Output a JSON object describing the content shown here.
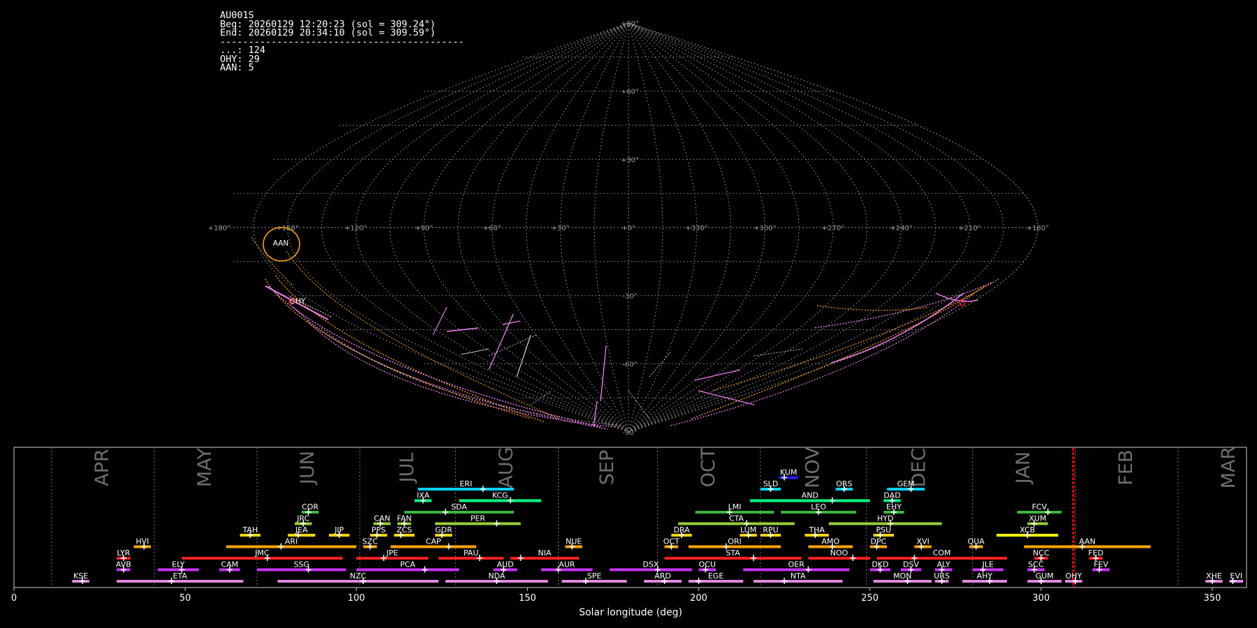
{
  "info": {
    "camera": "AU001S",
    "begin": "Beg: 20260129 12:20:23 (sol = 309.24°)",
    "end": "End: 20260129 20:34:10 (sol = 309.59°)",
    "divider": "-------------------------------------------",
    "counts": [
      "...: 124",
      "OHY: 29",
      "AAN: 5"
    ]
  },
  "sky": {
    "lon_labels": [
      "+180°",
      "+150°",
      "+120°",
      "+90°",
      "+60°",
      "+30°",
      "+0°",
      "+330°",
      "+300°",
      "+270°",
      "+240°",
      "+210°",
      "+180°"
    ],
    "lat_labels": [
      "+90°",
      "+60°",
      "+30°",
      "-30°",
      "-60°",
      "-90°"
    ],
    "radiant_labels": [
      "AAN",
      "OHY"
    ],
    "colors": {
      "grid": "#8a8a8a",
      "aan": "#ffa500",
      "ohy": "#ee82ee",
      "sporadic": "#bfbfbf"
    }
  },
  "timeline": {
    "title": "Solar longitude (deg)",
    "months": [
      "APR",
      "MAY",
      "JUN",
      "JUL",
      "AUG",
      "SEP",
      "OCT",
      "NOV",
      "DEC",
      "JAN",
      "FEB",
      "MAR"
    ],
    "xticks": [
      0,
      50,
      100,
      150,
      200,
      250,
      300,
      350
    ],
    "current_sol": 309.4
  },
  "chart_data": {
    "type": "timeline",
    "xlabel": "Solar longitude (deg)",
    "xlim": [
      0,
      360
    ],
    "current_marker_sol": 309.4,
    "showers": [
      {
        "code": "KUM",
        "start": 223.5,
        "end": 229,
        "peak": 225,
        "row": 9,
        "color": "#1e1eff"
      },
      {
        "code": "SLD",
        "start": 218,
        "end": 224,
        "peak": 221,
        "row": 8,
        "color": "#00d0ff"
      },
      {
        "code": "ORS",
        "start": 240,
        "end": 245,
        "peak": 242.5,
        "row": 8,
        "color": "#00d0ff"
      },
      {
        "code": "GEM",
        "start": 255,
        "end": 266,
        "peak": 262,
        "row": 8,
        "color": "#00d0ff"
      },
      {
        "code": "ERI",
        "start": 118,
        "end": 146,
        "peak": 137,
        "row": 8,
        "color": "#00d0ff"
      },
      {
        "code": "IXA",
        "start": 117,
        "end": 122,
        "peak": 119.5,
        "row": 7,
        "color": "#00ff7f"
      },
      {
        "code": "KCG",
        "start": 130,
        "end": 154,
        "peak": 145,
        "row": 7,
        "color": "#00ff7f"
      },
      {
        "code": "AND",
        "start": 215,
        "end": 250,
        "peak": 239,
        "row": 7,
        "color": "#00ff7f"
      },
      {
        "code": "DAD",
        "start": 254,
        "end": 259,
        "peak": 256.5,
        "row": 7,
        "color": "#00ff7f"
      },
      {
        "code": "COR",
        "start": 84,
        "end": 89,
        "peak": 86,
        "row": 6,
        "color": "#3cb43c"
      },
      {
        "code": "SDA",
        "start": 114,
        "end": 146,
        "peak": 126,
        "row": 6,
        "color": "#3cb43c"
      },
      {
        "code": "LMI",
        "start": 199,
        "end": 222,
        "peak": 209,
        "row": 6,
        "color": "#3cb43c"
      },
      {
        "code": "LEO",
        "start": 224,
        "end": 246,
        "peak": 235,
        "row": 6,
        "color": "#3cb43c"
      },
      {
        "code": "EHY",
        "start": 254,
        "end": 260,
        "peak": 257,
        "row": 6,
        "color": "#3cb43c"
      },
      {
        "code": "FCV",
        "start": 293,
        "end": 306,
        "peak": 302,
        "row": 6,
        "color": "#3cb43c"
      },
      {
        "code": "JRC",
        "start": 82,
        "end": 87,
        "peak": 84.5,
        "row": 5,
        "color": "#9acd32"
      },
      {
        "code": "CAN",
        "start": 105,
        "end": 110,
        "peak": 107,
        "row": 5,
        "color": "#9acd32"
      },
      {
        "code": "FAN",
        "start": 112,
        "end": 116,
        "peak": 114,
        "row": 5,
        "color": "#9acd32"
      },
      {
        "code": "PER",
        "start": 123,
        "end": 148,
        "peak": 141,
        "row": 5,
        "color": "#9acd32"
      },
      {
        "code": "CTA",
        "start": 194,
        "end": 228,
        "peak": 214,
        "row": 5,
        "color": "#9acd32"
      },
      {
        "code": "HYD",
        "start": 238,
        "end": 271,
        "peak": 256,
        "row": 5,
        "color": "#9acd32"
      },
      {
        "code": "XUM",
        "start": 296,
        "end": 302,
        "peak": 298,
        "row": 5,
        "color": "#9acd32"
      },
      {
        "code": "TAH",
        "start": 66,
        "end": 72,
        "peak": 69,
        "row": 4,
        "color": "#ffd700"
      },
      {
        "code": "JEA",
        "start": 80,
        "end": 88,
        "peak": 83,
        "row": 4,
        "color": "#ffd700"
      },
      {
        "code": "JIP",
        "start": 92,
        "end": 98,
        "peak": 95,
        "row": 4,
        "color": "#ffd700"
      },
      {
        "code": "PPS",
        "start": 104,
        "end": 109,
        "peak": 106,
        "row": 4,
        "color": "#ffd700"
      },
      {
        "code": "ZCS",
        "start": 111,
        "end": 117,
        "peak": 113,
        "row": 4,
        "color": "#ffd700"
      },
      {
        "code": "GDR",
        "start": 123,
        "end": 128,
        "peak": 125,
        "row": 4,
        "color": "#ffd700"
      },
      {
        "code": "DRA",
        "start": 192,
        "end": 198,
        "peak": 195,
        "row": 4,
        "color": "#ffd700"
      },
      {
        "code": "LUM",
        "start": 212,
        "end": 217,
        "peak": 214.5,
        "row": 4,
        "color": "#ffd700"
      },
      {
        "code": "RPU",
        "start": 218,
        "end": 224,
        "peak": 221,
        "row": 4,
        "color": "#ffd700"
      },
      {
        "code": "THA",
        "start": 231,
        "end": 238,
        "peak": 234,
        "row": 4,
        "color": "#ffd700"
      },
      {
        "code": "PSU",
        "start": 251,
        "end": 257,
        "peak": 253,
        "row": 4,
        "color": "#ffd700"
      },
      {
        "code": "XCB",
        "start": 287,
        "end": 305,
        "peak": 296,
        "row": 4,
        "color": "#ffff00"
      },
      {
        "code": "HVI",
        "start": 35,
        "end": 40,
        "peak": 38,
        "row": 3,
        "color": "#ffa500"
      },
      {
        "code": "ARI",
        "start": 62,
        "end": 100,
        "peak": 78,
        "row": 3,
        "color": "#ffa500"
      },
      {
        "code": "SZC",
        "start": 102,
        "end": 106,
        "peak": 104,
        "row": 3,
        "color": "#ffa500"
      },
      {
        "code": "CAP",
        "start": 110,
        "end": 135,
        "peak": 127,
        "row": 3,
        "color": "#ffa500"
      },
      {
        "code": "NUE",
        "start": 161,
        "end": 166,
        "peak": 163,
        "row": 3,
        "color": "#ffa500"
      },
      {
        "code": "OCT",
        "start": 190,
        "end": 194,
        "peak": 192,
        "row": 3,
        "color": "#ffa500"
      },
      {
        "code": "ORI",
        "start": 197,
        "end": 224,
        "peak": 208,
        "row": 3,
        "color": "#ffa500"
      },
      {
        "code": "AMO",
        "start": 232,
        "end": 245,
        "peak": 239,
        "row": 3,
        "color": "#ffa500"
      },
      {
        "code": "DPC",
        "start": 250,
        "end": 255,
        "peak": 252,
        "row": 3,
        "color": "#ffa500"
      },
      {
        "code": "XVI",
        "start": 263,
        "end": 268,
        "peak": 265,
        "row": 3,
        "color": "#ffa500"
      },
      {
        "code": "QUA",
        "start": 279,
        "end": 283,
        "peak": 281,
        "row": 3,
        "color": "#ffa500"
      },
      {
        "code": "AAN",
        "start": 295,
        "end": 332,
        "peak": 312,
        "row": 3,
        "color": "#ffa500"
      },
      {
        "code": "LYR",
        "start": 30,
        "end": 34,
        "peak": 32,
        "row": 2,
        "color": "#ff2020"
      },
      {
        "code": "JMC",
        "start": 49,
        "end": 96,
        "peak": 74,
        "row": 2,
        "color": "#ff2020"
      },
      {
        "code": "JPE",
        "start": 100,
        "end": 121,
        "peak": 108,
        "row": 2,
        "color": "#ff2020"
      },
      {
        "code": "PAU",
        "start": 124,
        "end": 143,
        "peak": 136,
        "row": 2,
        "color": "#ff2020"
      },
      {
        "code": "NIA",
        "start": 145,
        "end": 165,
        "peak": 148,
        "row": 2,
        "color": "#ff2020"
      },
      {
        "code": "STA",
        "start": 190,
        "end": 230,
        "peak": 216,
        "row": 2,
        "color": "#ff2020"
      },
      {
        "code": "NOO",
        "start": 232,
        "end": 250,
        "peak": 245,
        "row": 2,
        "color": "#ff2020"
      },
      {
        "code": "COM",
        "start": 252,
        "end": 290,
        "peak": 263,
        "row": 2,
        "color": "#ff2020"
      },
      {
        "code": "NCC",
        "start": 298,
        "end": 302,
        "peak": 300,
        "row": 2,
        "color": "#ff2020"
      },
      {
        "code": "FED",
        "start": 314,
        "end": 318,
        "peak": 316,
        "row": 2,
        "color": "#ff2020"
      },
      {
        "code": "AVB",
        "start": 30,
        "end": 34,
        "peak": 32,
        "row": 1,
        "color": "#cc33ff"
      },
      {
        "code": "ELY",
        "start": 42,
        "end": 54,
        "peak": 49,
        "row": 1,
        "color": "#cc33ff"
      },
      {
        "code": "CAM",
        "start": 60,
        "end": 66,
        "peak": 63,
        "row": 1,
        "color": "#cc33ff"
      },
      {
        "code": "SSG",
        "start": 71,
        "end": 97,
        "peak": 86,
        "row": 1,
        "color": "#cc33ff"
      },
      {
        "code": "PCA",
        "start": 100,
        "end": 130,
        "peak": 120,
        "row": 1,
        "color": "#cc33ff"
      },
      {
        "code": "AUD",
        "start": 140,
        "end": 147,
        "peak": 143,
        "row": 1,
        "color": "#cc33ff"
      },
      {
        "code": "AUR",
        "start": 154,
        "end": 169,
        "peak": 159,
        "row": 1,
        "color": "#cc33ff"
      },
      {
        "code": "DSX",
        "start": 174,
        "end": 198,
        "peak": 188,
        "row": 1,
        "color": "#cc33ff"
      },
      {
        "code": "OCU",
        "start": 200,
        "end": 205,
        "peak": 202,
        "row": 1,
        "color": "#cc33ff"
      },
      {
        "code": "OER",
        "start": 213,
        "end": 244,
        "peak": 232,
        "row": 1,
        "color": "#cc33ff"
      },
      {
        "code": "DKD",
        "start": 250,
        "end": 256,
        "peak": 253,
        "row": 1,
        "color": "#cc33ff"
      },
      {
        "code": "DSV",
        "start": 259,
        "end": 265,
        "peak": 262,
        "row": 1,
        "color": "#cc33ff"
      },
      {
        "code": "ALY",
        "start": 269,
        "end": 274,
        "peak": 271,
        "row": 1,
        "color": "#cc33ff"
      },
      {
        "code": "ILE",
        "start": 280,
        "end": 289,
        "peak": 283,
        "row": 1,
        "color": "#cc33ff"
      },
      {
        "code": "SCC",
        "start": 296,
        "end": 301,
        "peak": 298,
        "row": 1,
        "color": "#cc33ff"
      },
      {
        "code": "FEV",
        "start": 315,
        "end": 320,
        "peak": 317,
        "row": 1,
        "color": "#cc33ff"
      },
      {
        "code": "KSE",
        "start": 17,
        "end": 22,
        "peak": 20,
        "row": 0,
        "color": "#dd88dd"
      },
      {
        "code": "ETA",
        "start": 30,
        "end": 67,
        "peak": 46,
        "row": 0,
        "color": "#dd88dd"
      },
      {
        "code": "NZC",
        "start": 77,
        "end": 124,
        "peak": 102,
        "row": 0,
        "color": "#dd88dd"
      },
      {
        "code": "NDA",
        "start": 126,
        "end": 156,
        "peak": 141,
        "row": 0,
        "color": "#dd88dd"
      },
      {
        "code": "SPE",
        "start": 160,
        "end": 179,
        "peak": 167,
        "row": 0,
        "color": "#dd88dd"
      },
      {
        "code": "ARD",
        "start": 184,
        "end": 195,
        "peak": 190,
        "row": 0,
        "color": "#dd88dd"
      },
      {
        "code": "EGE",
        "start": 197,
        "end": 213,
        "peak": 200,
        "row": 0,
        "color": "#dd88dd"
      },
      {
        "code": "NTA",
        "start": 216,
        "end": 242,
        "peak": 225,
        "row": 0,
        "color": "#dd88dd"
      },
      {
        "code": "MON",
        "start": 251,
        "end": 268,
        "peak": 261,
        "row": 0,
        "color": "#dd88dd"
      },
      {
        "code": "URS",
        "start": 269,
        "end": 273,
        "peak": 271,
        "row": 0,
        "color": "#dd88dd"
      },
      {
        "code": "AHY",
        "start": 277,
        "end": 290,
        "peak": 285,
        "row": 0,
        "color": "#dd88dd"
      },
      {
        "code": "GUM",
        "start": 296,
        "end": 306,
        "peak": 300,
        "row": 0,
        "color": "#dd88dd"
      },
      {
        "code": "OHY",
        "start": 307,
        "end": 312,
        "peak": 310,
        "row": 0,
        "color": "#dd88dd"
      },
      {
        "code": "XHE",
        "start": 348,
        "end": 353,
        "peak": 350,
        "row": 0,
        "color": "#dd88dd"
      },
      {
        "code": "EVI",
        "start": 355,
        "end": 359,
        "peak": 356,
        "row": 0,
        "color": "#dd88dd"
      }
    ]
  }
}
